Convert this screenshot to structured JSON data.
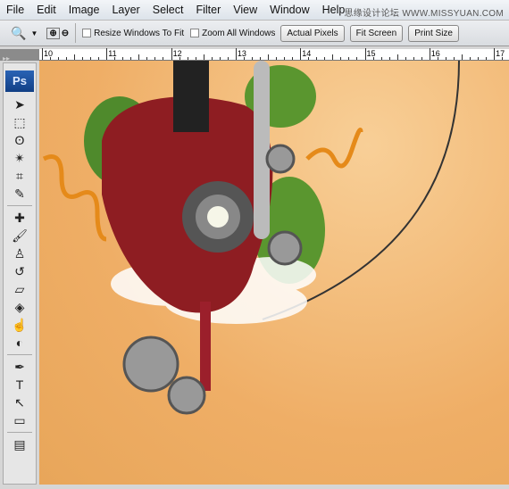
{
  "menu": [
    "File",
    "Edit",
    "Image",
    "Layer",
    "Select",
    "Filter",
    "View",
    "Window",
    "Help"
  ],
  "watermark": "思缘设计论坛 WWW.MISSYUAN.COM",
  "options": {
    "resize_label": "Resize Windows To Fit",
    "zoom_all_label": "Zoom All Windows",
    "actual_pixels": "Actual Pixels",
    "fit_screen": "Fit Screen",
    "print_size": "Print Size",
    "resize_checked": false,
    "zoom_all_checked": false
  },
  "ruler": [
    "10",
    "11",
    "12",
    "13",
    "14",
    "15",
    "16",
    "17"
  ],
  "app_logo": "Ps",
  "tools": [
    "move",
    "marquee",
    "lasso",
    "magic-wand",
    "crop",
    "eyedropper",
    "|",
    "healing-brush",
    "brush",
    "clone-stamp",
    "history-brush",
    "eraser",
    "paint-bucket",
    "smudge",
    "dodge",
    "|",
    "pen",
    "type",
    "path-selection",
    "shape",
    "|",
    "notes"
  ],
  "colors": {
    "canvas": "#efae66",
    "heart": "#8e1d22",
    "logo": "#1f4f9c"
  }
}
